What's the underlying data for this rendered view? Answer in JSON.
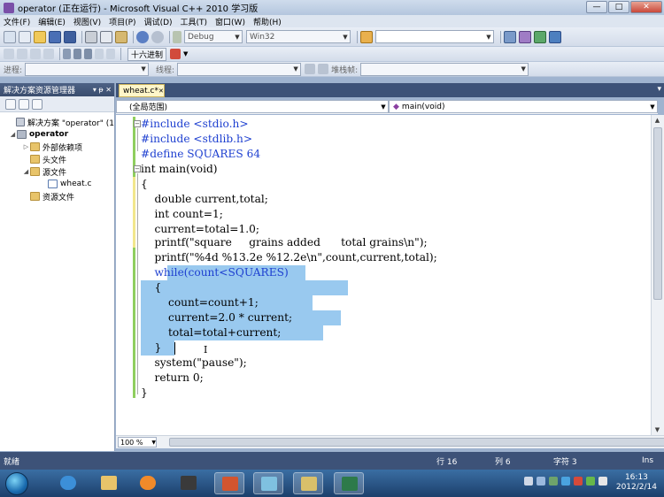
{
  "window": {
    "title": "operator (正在运行) - Microsoft Visual C++ 2010 学习版",
    "buttons": [
      "—",
      "□",
      "✕"
    ]
  },
  "menu": [
    "文件(F)",
    "编辑(E)",
    "视图(V)",
    "项目(P)",
    "调试(D)",
    "工具(T)",
    "窗口(W)",
    "帮助(H)"
  ],
  "toolbar": {
    "config": "Debug",
    "platform": "Win32",
    "hex_label": "十六进制",
    "process_label": "进程:",
    "thread_label": "线程:",
    "stackframe_label": "堆栈帧:"
  },
  "solution_explorer": {
    "title": "解决方案资源管理器",
    "header_buttons": "▾ ᵽ ✕",
    "items": [
      {
        "label": "解决方案 \"operator\" (1",
        "level": 0,
        "icon": "solution-icon",
        "expander": ""
      },
      {
        "label": "operator",
        "level": 1,
        "icon": "project-icon",
        "expander": "◢",
        "bold": true
      },
      {
        "label": "外部依赖项",
        "level": 2,
        "icon": "folder-icon",
        "expander": "▷"
      },
      {
        "label": "头文件",
        "level": 2,
        "icon": "folder-icon",
        "expander": ""
      },
      {
        "label": "源文件",
        "level": 2,
        "icon": "folder-icon",
        "expander": "◢"
      },
      {
        "label": "wheat.c",
        "level": 3,
        "icon": "c-file-icon",
        "expander": ""
      },
      {
        "label": "资源文件",
        "level": 2,
        "icon": "folder-icon",
        "expander": ""
      }
    ]
  },
  "editor": {
    "tab_label": "wheat.c*",
    "tab_close": "✕",
    "scope_combo": "(全局范围)",
    "function_combo": "main(void)",
    "zoom": "100 %",
    "code_lines": [
      "#include <stdio.h>",
      "#include <stdlib.h>",
      "#define SQUARES 64",
      "int main(void)",
      "{",
      "    double current,total;",
      "    int count=1;",
      "    current=total=1.0;",
      "    printf(\"square     grains added      total grains\\n\");",
      "    printf(\"%4d %13.2e %12.2e\\n\",count,current,total);",
      "    while(count<SQUARES)",
      "    {",
      "        count=count+1;",
      "        current=2.0 * current;",
      "        total=total+current;",
      "    }",
      "    system(\"pause\");",
      "    return 0;",
      "}"
    ]
  },
  "status": {
    "ready": "就绪",
    "line": "行 16",
    "column": "列 6",
    "char": "字符 3",
    "mode": "Ins"
  },
  "clock": {
    "time": "16:13",
    "date": "2012/2/14"
  }
}
